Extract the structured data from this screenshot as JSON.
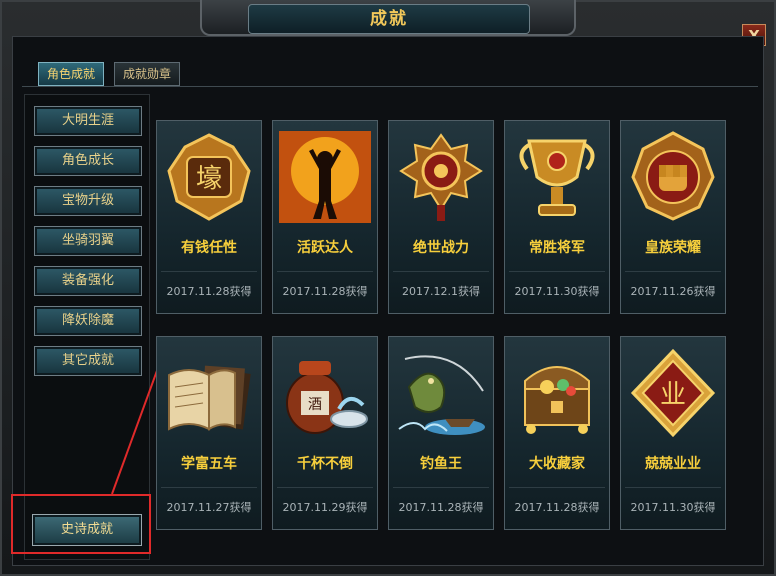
{
  "window": {
    "title": "成就",
    "close_label": "X"
  },
  "tabs": [
    {
      "label": "角色成就",
      "active": true
    },
    {
      "label": "成就勋章",
      "active": false
    }
  ],
  "categories": [
    {
      "label": "大明生涯"
    },
    {
      "label": "角色成长"
    },
    {
      "label": "宝物升级"
    },
    {
      "label": "坐骑羽翼"
    },
    {
      "label": "装备强化"
    },
    {
      "label": "降妖除魔"
    },
    {
      "label": "其它成就"
    }
  ],
  "epic_button": {
    "label": "史诗成就"
  },
  "achievements": [
    {
      "name": "有钱任性",
      "date": "2017.11.28获得",
      "icon": "rich-medal-icon"
    },
    {
      "name": "活跃达人",
      "date": "2017.11.28获得",
      "icon": "active-figure-icon"
    },
    {
      "name": "绝世战力",
      "date": "2017.12.1获得",
      "icon": "power-emblem-icon"
    },
    {
      "name": "常胜将军",
      "date": "2017.11.30获得",
      "icon": "trophy-cup-icon"
    },
    {
      "name": "皇族荣耀",
      "date": "2017.11.26获得",
      "icon": "royal-fist-icon"
    },
    {
      "name": "学富五车",
      "date": "2017.11.27获得",
      "icon": "books-icon"
    },
    {
      "name": "千杯不倒",
      "date": "2017.11.29获得",
      "icon": "wine-jar-icon"
    },
    {
      "name": "钓鱼王",
      "date": "2017.11.28获得",
      "icon": "fishing-icon"
    },
    {
      "name": "大收藏家",
      "date": "2017.11.28获得",
      "icon": "treasure-chest-icon"
    },
    {
      "name": "兢兢业业",
      "date": "2017.11.30获得",
      "icon": "diligence-badge-icon"
    }
  ],
  "colors": {
    "accent_gold": "#f7cf3c",
    "highlight_red": "#e02a2a",
    "panel_teal": "#2e5a68"
  }
}
